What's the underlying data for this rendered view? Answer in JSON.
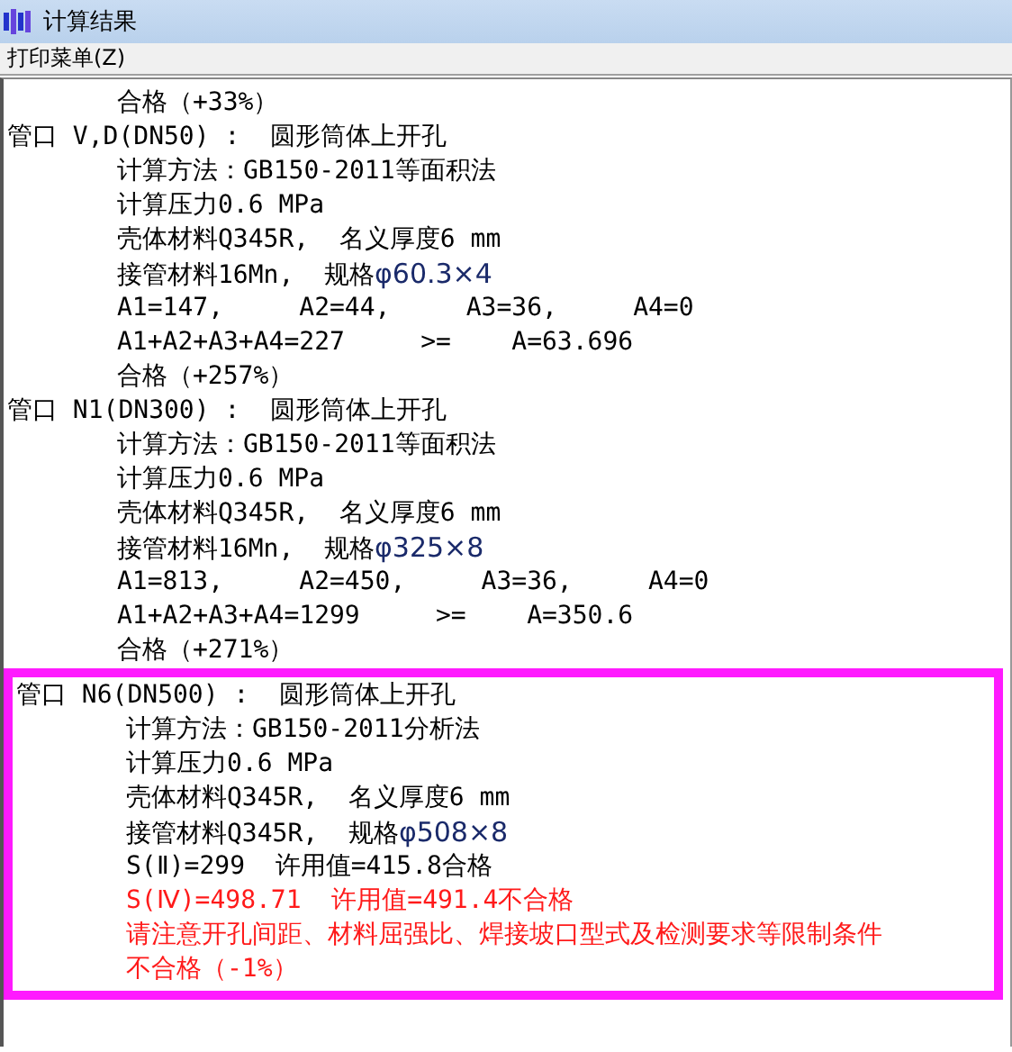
{
  "window": {
    "title": "计算结果"
  },
  "menu": [
    {
      "label": "打印菜单(Z)"
    }
  ],
  "lines": [
    {
      "kind": "detail",
      "text": "合格（+33%）",
      "warning": false
    },
    {
      "kind": "heading",
      "text": "管口 V,D(DN50) :  圆形筒体上开孔",
      "warning": false
    },
    {
      "kind": "detail",
      "text": "计算方法：GB150-2011等面积法",
      "warning": false
    },
    {
      "kind": "detail",
      "text": "计算压力0.6 MPa",
      "warning": false
    },
    {
      "kind": "detail",
      "text": "壳体材料Q345R,  名义厚度6 mm",
      "warning": false
    },
    {
      "kind": "detail",
      "text": "接管材料16Mn,  规格",
      "spec": "φ60.3×4",
      "warning": false
    },
    {
      "kind": "detail",
      "text": "A1=147,     A2=44,     A3=36,     A4=0",
      "warning": false
    },
    {
      "kind": "detail",
      "text": "A1+A2+A3+A4=227     >=    A=63.696",
      "warning": false
    },
    {
      "kind": "detail",
      "text": "合格（+257%）",
      "warning": false
    },
    {
      "kind": "heading",
      "text": "管口 N1(DN300) :  圆形筒体上开孔",
      "warning": false
    },
    {
      "kind": "detail",
      "text": "计算方法：GB150-2011等面积法",
      "warning": false
    },
    {
      "kind": "detail",
      "text": "计算压力0.6 MPa",
      "warning": false
    },
    {
      "kind": "detail",
      "text": "壳体材料Q345R,  名义厚度6 mm",
      "warning": false
    },
    {
      "kind": "detail",
      "text": "接管材料16Mn,  规格",
      "spec": "φ325×8",
      "warning": false
    },
    {
      "kind": "detail",
      "text": "A1=813,     A2=450,     A3=36,     A4=0",
      "warning": false
    },
    {
      "kind": "detail",
      "text": "A1+A2+A3+A4=1299     >=    A=350.6",
      "warning": false
    },
    {
      "kind": "detail",
      "text": "合格（+271%）",
      "warning": false
    }
  ],
  "highlight": {
    "lines": [
      {
        "kind": "heading",
        "text": "管口 N6(DN500) :  圆形筒体上开孔",
        "warning": false
      },
      {
        "kind": "detail",
        "text": "计算方法：GB150-2011分析法",
        "warning": false
      },
      {
        "kind": "detail",
        "text": "计算压力0.6 MPa",
        "warning": false
      },
      {
        "kind": "detail",
        "text": "壳体材料Q345R,  名义厚度6 mm",
        "warning": false
      },
      {
        "kind": "detail",
        "text": "接管材料Q345R,  规格",
        "spec": "φ508×8",
        "warning": false
      },
      {
        "kind": "detail",
        "text": "S(Ⅱ)=299  许用值=415.8合格",
        "warning": false
      },
      {
        "kind": "detail",
        "text": "S(Ⅳ)=498.71  许用值=491.4不合格",
        "warning": true
      },
      {
        "kind": "detail",
        "text": "请注意开孔间距、材料屈强比、焊接坡口型式及检测要求等限制条件",
        "warning": true
      },
      {
        "kind": "detail",
        "text": "不合格（-1%）",
        "warning": true
      }
    ]
  }
}
